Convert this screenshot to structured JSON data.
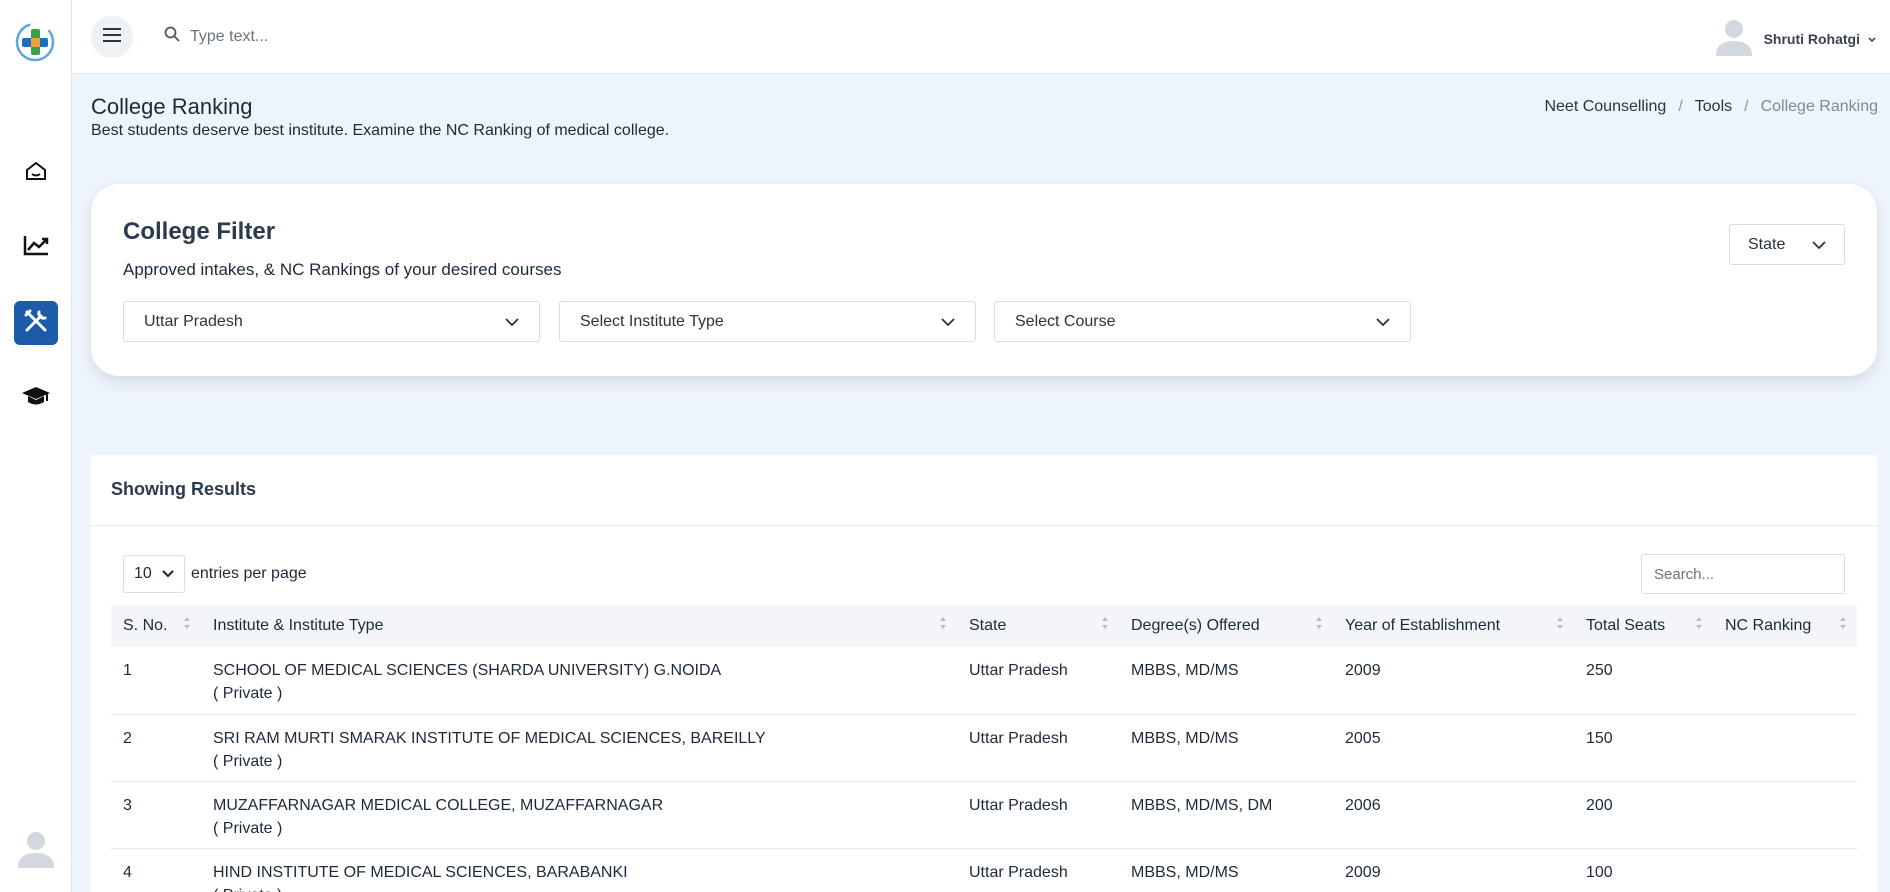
{
  "topbar": {
    "search_placeholder": "Type text...",
    "user_name": "Shruti Rohatgi"
  },
  "page": {
    "title": "College Ranking",
    "subtitle": "Best students deserve best institute. Examine the NC Ranking of medical college.",
    "breadcrumb": [
      "Neet Counselling",
      "Tools",
      "College Ranking"
    ],
    "breadcrumb_sep": "/"
  },
  "filter": {
    "title": "College Filter",
    "subtitle": "Approved intakes, & NC Rankings of your desired courses",
    "state_button": "State",
    "state_select": "Uttar Pradesh",
    "institute_select": "Select Institute Type",
    "course_select": "Select Course"
  },
  "results": {
    "heading": "Showing Results",
    "entries_value": "10",
    "entries_label": "entries per page",
    "search_placeholder": "Search...",
    "columns": [
      "S. No.",
      "Institute & Institute Type",
      "State",
      "Degree(s) Offered",
      "Year of Establishment",
      "Total Seats",
      "NC Ranking"
    ],
    "rows": [
      {
        "sno": "1",
        "institute": "SCHOOL OF MEDICAL SCIENCES (SHARDA UNIVERSITY) G.NOIDA",
        "type": "( Private )",
        "state": "Uttar Pradesh",
        "degrees": "MBBS, MD/MS",
        "year": "2009",
        "seats": "250",
        "ranking": ""
      },
      {
        "sno": "2",
        "institute": "SRI RAM MURTI SMARAK INSTITUTE OF MEDICAL SCIENCES, BAREILLY",
        "type": "( Private )",
        "state": "Uttar Pradesh",
        "degrees": "MBBS, MD/MS",
        "year": "2005",
        "seats": "150",
        "ranking": ""
      },
      {
        "sno": "3",
        "institute": "MUZAFFARNAGAR MEDICAL COLLEGE, MUZAFFARNAGAR",
        "type": "( Private )",
        "state": "Uttar Pradesh",
        "degrees": "MBBS, MD/MS, DM",
        "year": "2006",
        "seats": "200",
        "ranking": ""
      },
      {
        "sno": "4",
        "institute": "HIND INSTITUTE OF MEDICAL SCIENCES, BARABANKI",
        "type": "( Private )",
        "state": "Uttar Pradesh",
        "degrees": "MBBS, MD/MS",
        "year": "2009",
        "seats": "100",
        "ranking": ""
      }
    ]
  },
  "icons": {
    "sidebar": [
      "home-icon",
      "chart-icon",
      "tools-icon",
      "graduation-cap-icon"
    ],
    "accent_color": "#1d5ba8"
  }
}
